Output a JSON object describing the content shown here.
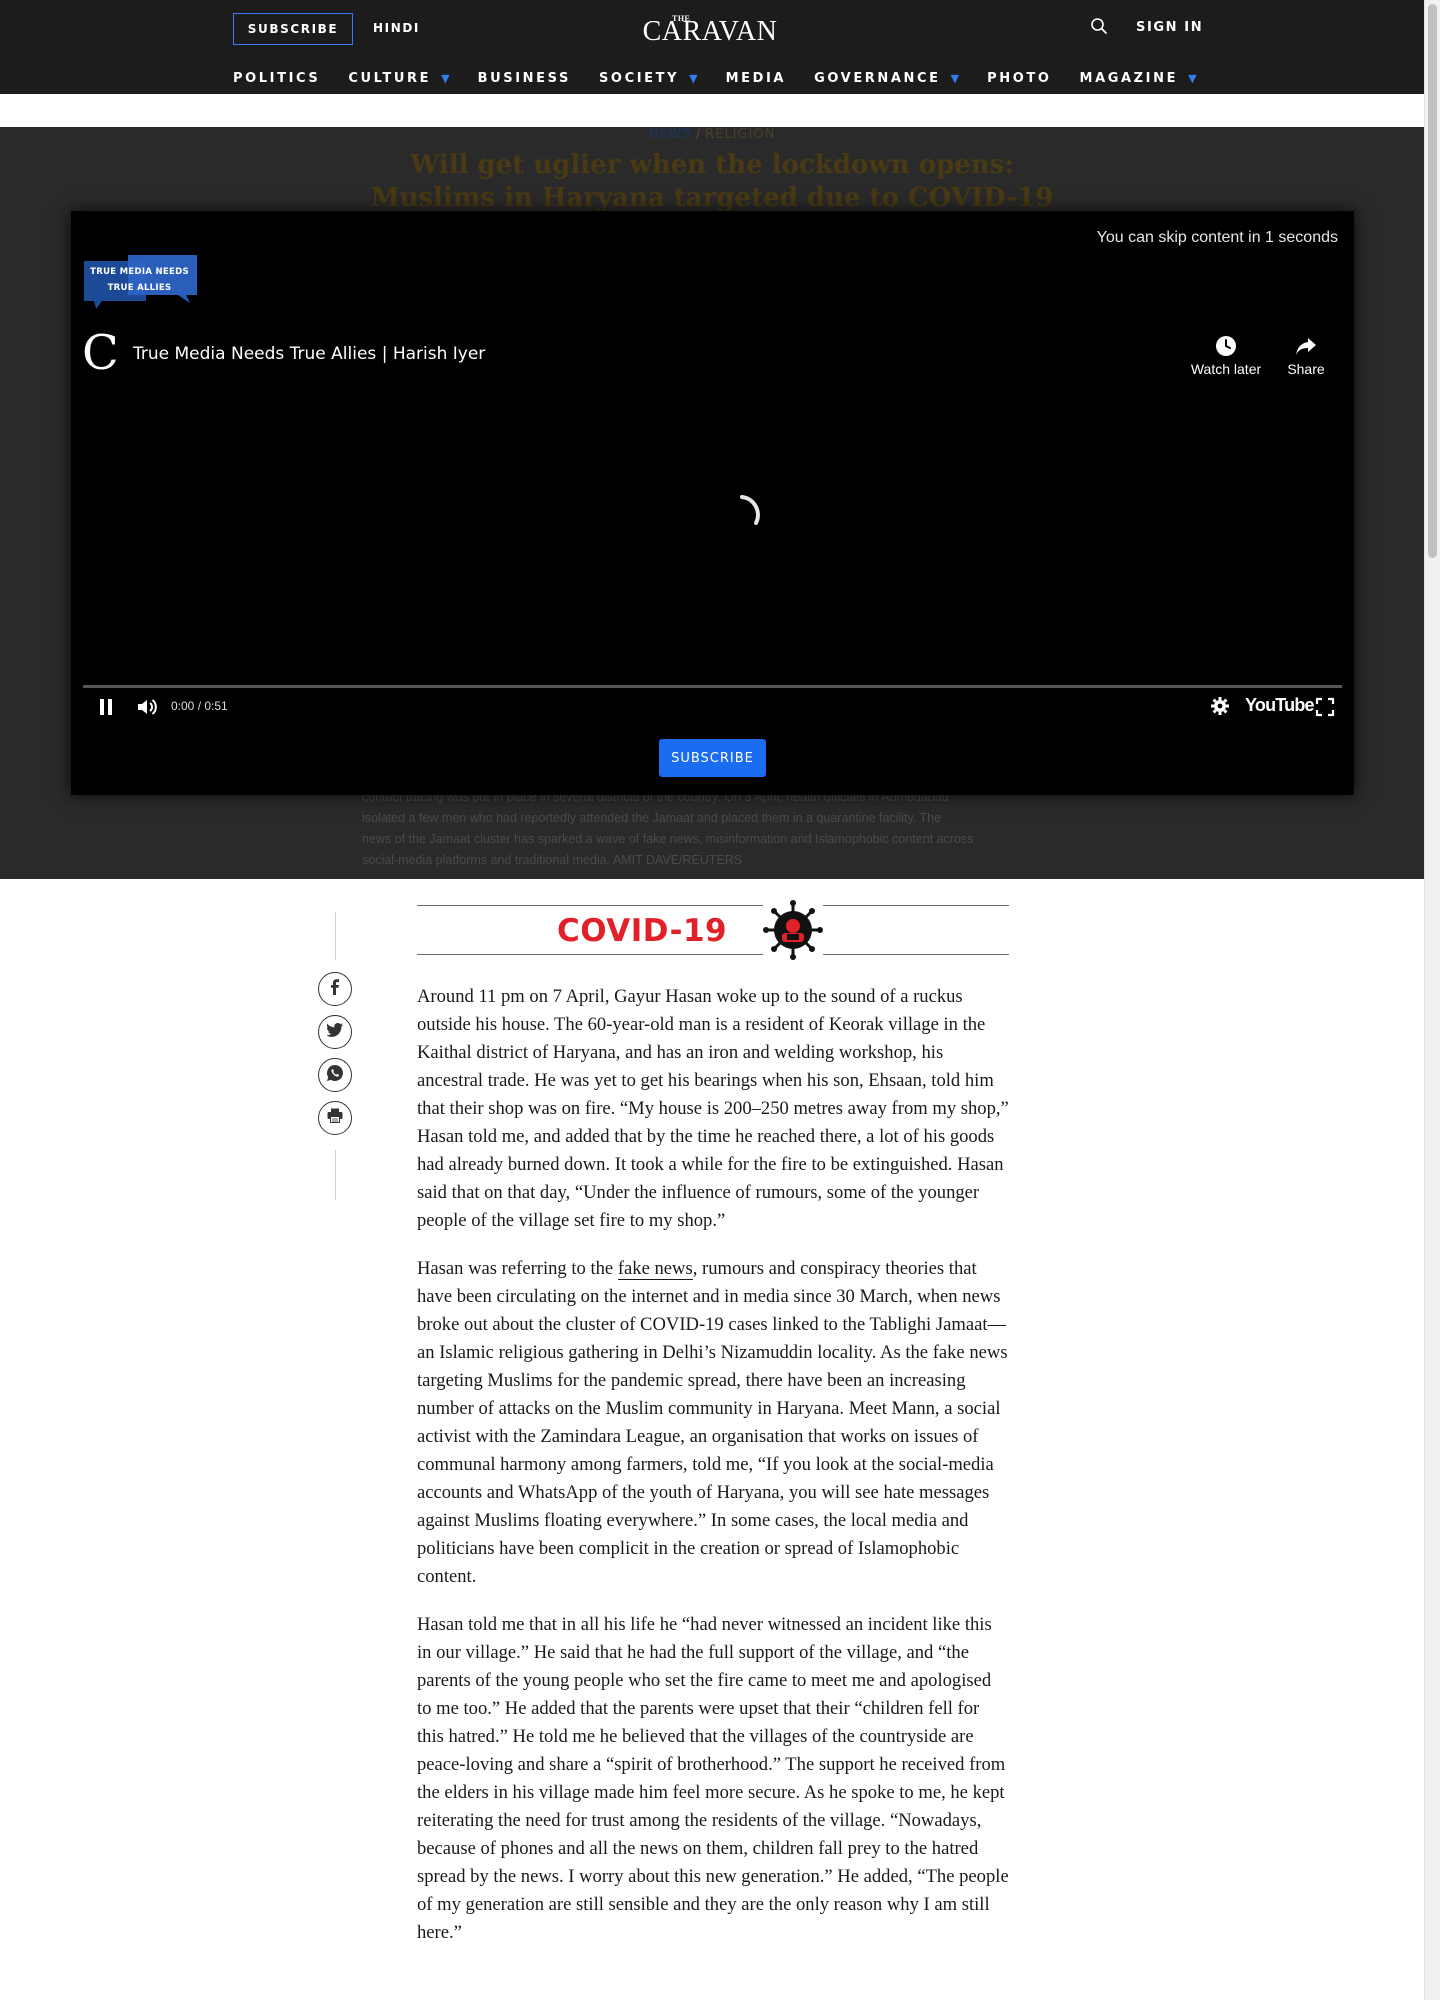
{
  "header": {
    "subscribe_label": "SUBSCRIBE",
    "hindi_label": "HINDI",
    "logo_small": "THE",
    "logo_main": "CARAVAN",
    "signin_label": "SIGN IN",
    "nav": [
      {
        "label": "POLITICS",
        "dropdown": false
      },
      {
        "label": "CULTURE",
        "dropdown": true
      },
      {
        "label": "BUSINESS",
        "dropdown": false
      },
      {
        "label": "SOCIETY",
        "dropdown": true
      },
      {
        "label": "MEDIA",
        "dropdown": false
      },
      {
        "label": "GOVERNANCE",
        "dropdown": true
      },
      {
        "label": "PHOTO",
        "dropdown": false
      },
      {
        "label": "MAGAZINE",
        "dropdown": true
      }
    ],
    "caret_glyph": "▼"
  },
  "article_head": {
    "breadcrumb_section": "NEWS",
    "breadcrumb_sep": "/",
    "breadcrumb_topic": "RELIGION",
    "headline": "Will get uglier when the lockdown opens: Muslims in Haryana targeted due to COVID-19 rumours",
    "caption_lines": [
      "contact tracing was put in place in several districts of the country. On 3 April, health officials in Ahmedabad",
      "isolated a few men who had reportedly attended the Jamaat and placed them in a quarantine facility. The",
      "news of the Jamaat cluster has sparked a wave of fake news, misinformation and Islamophobic content across"
    ],
    "caption_last": "social-media platforms and traditional media.",
    "caption_credit": "AMIT DAVE/REUTERS"
  },
  "player": {
    "skip_text": "You can skip content in 1 seconds",
    "badge_line1": "TRUE MEDIA NEEDS",
    "badge_line2": "TRUE ALLIES",
    "channel_letter": "C",
    "video_title": "True Media Needs True Allies | Harish Iyer",
    "watch_later_label": "Watch later",
    "share_label": "Share",
    "time": "0:00 / 0:51",
    "progress_fraction": 0,
    "youtube_label": "YouTube",
    "subscribe_label": "SUBSCRIBE"
  },
  "share_buttons": [
    {
      "name": "facebook-share-button",
      "icon": "facebook-icon"
    },
    {
      "name": "twitter-share-button",
      "icon": "twitter-icon"
    },
    {
      "name": "whatsapp-share-button",
      "icon": "whatsapp-icon"
    },
    {
      "name": "print-button",
      "icon": "print-icon"
    }
  ],
  "covid_banner": {
    "label": "COVID-19",
    "color": "#e1202a"
  },
  "body": {
    "p1": "Around 11 pm on 7 April, Gayur Hasan woke up to the sound of a ruckus outside his house. The 60-year-old man is a resident of Keorak village in the Kaithal district of Haryana, and has an iron and welding workshop, his ancestral trade. He was yet to get his bearings when his son, Ehsaan, told him that their shop was on fire. “My house is 200–250 metres away from my shop,” Hasan told me, and added that by the time he reached there, a lot of his goods had already burned down. It took a while for the fire to be extinguished. Hasan said that on that day, “Under the influence of rumours, some of the younger people of the village set fire to my shop.”",
    "p2_before": "Hasan was referring to the ",
    "p2_link": "fake news",
    "p2_after": ", rumours and conspiracy theories that have been circulating on the internet and in media since 30 March, when news broke out about the cluster of COVID-19 cases linked to the Tablighi Jamaat—an Islamic religious gathering in Delhi’s Nizamuddin locality. As the fake news targeting Muslims for the pandemic spread, there have been an increasing number of attacks on the Muslim community in Haryana. Meet Mann, a social activist with the Zamindara League, an organisation that works on issues of communal harmony among farmers, told me, “If you look at the social-media accounts and WhatsApp of the youth of Haryana, you will see hate messages against Muslims floating everywhere.” In some cases, the local media and politicians have been complicit in the creation or spread of Islamophobic content.",
    "p3": "Hasan told me that in all his life he “had never witnessed an incident like this in our village.” He said that he had the full support of the village, and “the parents of the young people who set the fire came to meet me and apologised to me too.” He added that the parents were upset that their “children fell for this hatred.” He told me he believed that the villages of the countryside are peace-loving and share a “spirit of brotherhood.” The support he received from the elders in his village made him feel more secure. As he spoke to me, he kept reiterating the need for trust among the residents of the village. “Nowadays, because of phones and all the news on them, children fall prey to the hatred spread by the news. I worry about this new generation.” He added, “The people of my generation are still sensible and they are the only reason why I am still here.”"
  },
  "colors": {
    "header_bg": "#1c1c1c",
    "accent_blue": "#2f7ff2",
    "player_subscribe": "#1a6cf0"
  }
}
